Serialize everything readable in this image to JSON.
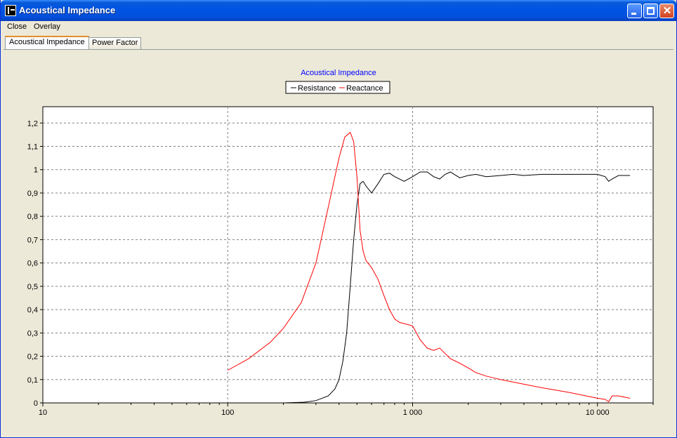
{
  "window": {
    "title": "Acoustical Impedance"
  },
  "menu": {
    "close_label": "Close",
    "overlay_label": "Overlay"
  },
  "tabs": [
    {
      "label": "Acoustical Impedance",
      "active": true
    },
    {
      "label": "Power Factor",
      "active": false
    }
  ],
  "chart_data": {
    "type": "line",
    "title": "Acoustical Impedance",
    "xscale": "log",
    "xlim": [
      10,
      20000
    ],
    "ylim": [
      0,
      1.27
    ],
    "xticks": [
      10,
      100,
      1000,
      10000
    ],
    "xtick_labels": [
      "10",
      "100",
      "1 000",
      "10 000"
    ],
    "yticks": [
      0,
      0.1,
      0.2,
      0.3,
      0.4,
      0.5,
      0.6,
      0.7,
      0.8,
      0.9,
      1,
      1.1,
      1.2
    ],
    "ytick_labels": [
      "0",
      "0,1",
      "0,2",
      "0,3",
      "0,4",
      "0,5",
      "0,6",
      "0,7",
      "0,8",
      "0,9",
      "1",
      "1,1",
      "1,2"
    ],
    "grid": true,
    "legend_position": "top-center",
    "series": [
      {
        "name": "Resistance",
        "color": "#000000",
        "x": [
          100,
          200,
          260,
          300,
          350,
          380,
          400,
          420,
          440,
          460,
          480,
          500,
          520,
          540,
          560,
          600,
          650,
          700,
          750,
          800,
          900,
          1000,
          1100,
          1200,
          1300,
          1400,
          1500,
          1600,
          1800,
          2000,
          2200,
          2500,
          3000,
          3500,
          4000,
          5000,
          6000,
          8000,
          10000,
          11000,
          11500,
          12000,
          13000,
          15000
        ],
        "y": [
          0,
          0,
          0.003,
          0.01,
          0.03,
          0.06,
          0.1,
          0.18,
          0.3,
          0.5,
          0.7,
          0.85,
          0.94,
          0.95,
          0.93,
          0.9,
          0.94,
          0.98,
          0.985,
          0.97,
          0.95,
          0.97,
          0.99,
          0.99,
          0.97,
          0.96,
          0.98,
          0.99,
          0.965,
          0.975,
          0.98,
          0.97,
          0.975,
          0.98,
          0.975,
          0.98,
          0.98,
          0.98,
          0.98,
          0.97,
          0.95,
          0.96,
          0.975,
          0.975
        ]
      },
      {
        "name": "Reactance",
        "color": "#ff0000",
        "x": [
          100,
          130,
          170,
          200,
          250,
          300,
          350,
          400,
          430,
          460,
          480,
          500,
          520,
          540,
          560,
          600,
          650,
          700,
          750,
          800,
          850,
          900,
          1000,
          1100,
          1200,
          1300,
          1400,
          1600,
          1800,
          2000,
          2200,
          2500,
          3000,
          4000,
          5000,
          7000,
          10000,
          11000,
          11500,
          12000,
          13000,
          15000
        ],
        "y": [
          0.14,
          0.19,
          0.26,
          0.32,
          0.43,
          0.6,
          0.84,
          1.05,
          1.14,
          1.16,
          1.12,
          0.97,
          0.74,
          0.65,
          0.61,
          0.58,
          0.53,
          0.46,
          0.4,
          0.36,
          0.345,
          0.34,
          0.33,
          0.27,
          0.235,
          0.225,
          0.235,
          0.19,
          0.17,
          0.15,
          0.13,
          0.115,
          0.1,
          0.08,
          0.065,
          0.045,
          0.02,
          0.015,
          0.005,
          0.03,
          0.03,
          0.02
        ]
      }
    ]
  }
}
